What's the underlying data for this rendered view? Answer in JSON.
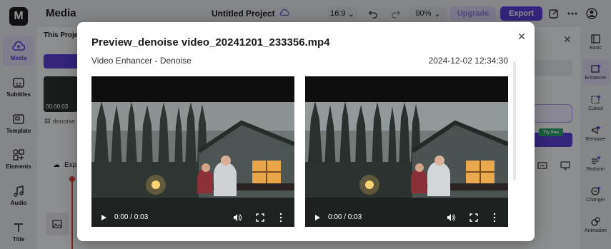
{
  "topbar": {
    "app_title": "Media",
    "project_title": "Untitled Project",
    "ratio": "16:9",
    "zoom": "90%",
    "upgrade_label": "Upgrade",
    "export_label": "Export"
  },
  "left_rail": {
    "items": [
      {
        "label": "Media",
        "icon": "media-cloud-icon"
      },
      {
        "label": "Subtitles",
        "icon": "subtitles-icon"
      },
      {
        "label": "Template",
        "icon": "template-icon"
      },
      {
        "label": "Elements",
        "icon": "elements-icon"
      },
      {
        "label": "Audio",
        "icon": "audio-icon"
      },
      {
        "label": "Title",
        "icon": "title-icon"
      }
    ]
  },
  "panel": {
    "tab_label": "This Project",
    "thumb_duration": "00:00:03",
    "thumb_name": "denoise",
    "export_label": "Exp"
  },
  "right_panel": {
    "try_free": "Try free"
  },
  "right_rail": {
    "items": [
      {
        "label": "Basic"
      },
      {
        "label": "Enhancer"
      },
      {
        "label": "Cutout"
      },
      {
        "label": "Remover"
      },
      {
        "label": "Reducer"
      },
      {
        "label": "Changer"
      },
      {
        "label": "Animation"
      }
    ]
  },
  "modal": {
    "title": "Preview_denoise video_20241201_233356.mp4",
    "subtitle": "Video Enhancer - Denoise",
    "timestamp": "2024-12-02 12:34:30",
    "videos": [
      {
        "time": "0:00 / 0:03"
      },
      {
        "time": "0:00 / 0:03"
      }
    ]
  },
  "colors": {
    "accent": "#5b3fd6",
    "upgrade_bg": "#d9d3f5",
    "try_free_bg": "#2ba36a"
  }
}
